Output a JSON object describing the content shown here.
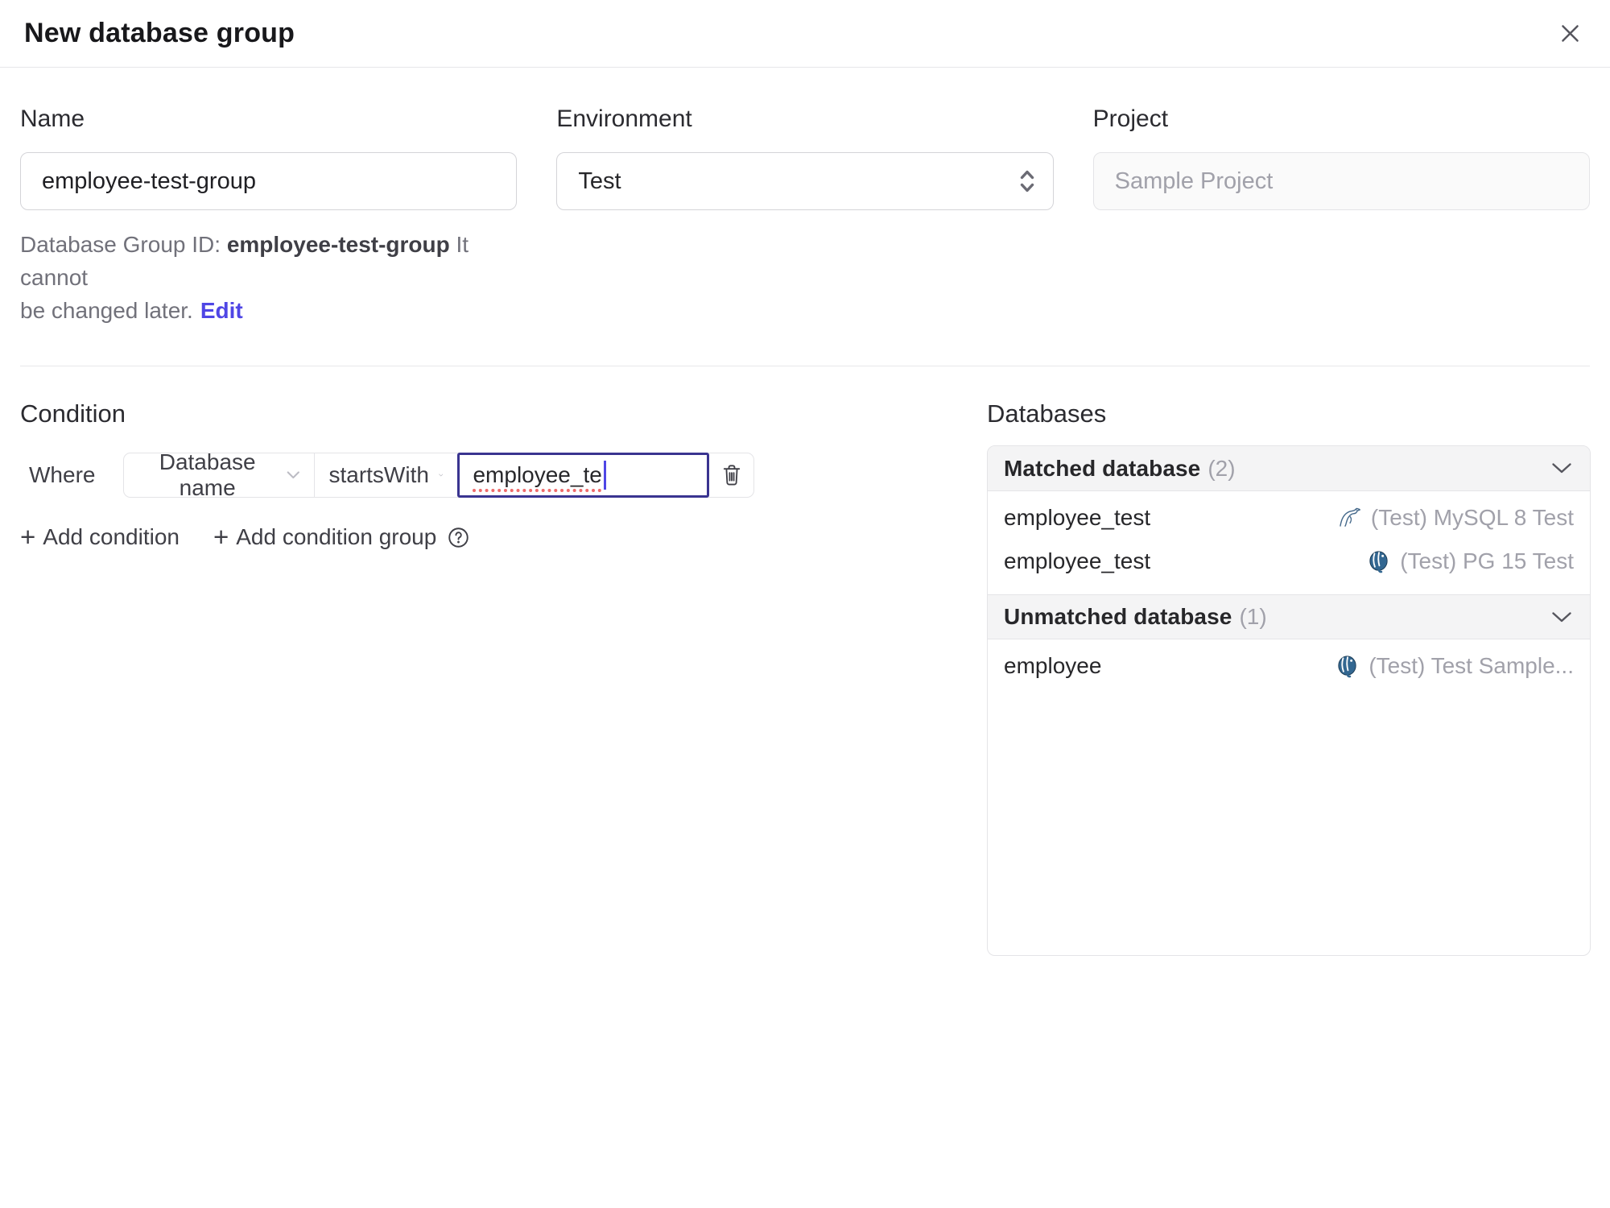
{
  "dialog": {
    "title": "New database group"
  },
  "form": {
    "name": {
      "label": "Name",
      "value": "employee-test-group"
    },
    "environment": {
      "label": "Environment",
      "value": "Test"
    },
    "project": {
      "label": "Project",
      "value": "Sample Project"
    },
    "group_id_note": {
      "prefix": "Database Group ID: ",
      "id": "employee-test-group",
      "suffix_line1": " It cannot",
      "suffix_line2": "be changed later.",
      "edit_link": "Edit"
    }
  },
  "condition": {
    "heading": "Condition",
    "where_label": "Where",
    "field": "Database name",
    "operator": "startsWith",
    "value": "employee_te",
    "plus": "+",
    "add_condition_label": "Add condition",
    "add_condition_group_label": "Add condition group"
  },
  "databases": {
    "heading": "Databases",
    "sections": [
      {
        "title": "Matched database",
        "count": "(2)",
        "rows": [
          {
            "name": "employee_test",
            "engine": "mysql",
            "instance": "(Test) MySQL 8 Test"
          },
          {
            "name": "employee_test",
            "engine": "postgres",
            "instance": "(Test) PG 15 Test"
          }
        ]
      },
      {
        "title": "Unmatched database",
        "count": "(1)",
        "rows": [
          {
            "name": "employee",
            "engine": "postgres",
            "instance": "(Test) Test Sample..."
          }
        ]
      }
    ]
  },
  "icons": {
    "close": "x-icon",
    "environment_selector": "chevron-up-down-icon",
    "condition_dropdowns": "chevron-down-icon",
    "delete_condition": "trash-icon",
    "help": "question-circle-icon",
    "section_collapse": "chevron-down-icon",
    "mysql_engine": "mysql-dolphin-icon",
    "postgres_engine": "postgres-elephant-icon"
  },
  "colors": {
    "accent_link": "#4f46e5",
    "focused_input_border": "#3a3490",
    "spellcheck_underline": "#ef6b6b",
    "mysql_icon_blue": "#44688a",
    "postgres_icon_blue": "#336791",
    "panel_header_bg": "#f4f4f5",
    "border": "#e4e4e7",
    "text_primary": "#27272a",
    "text_secondary": "#71717a",
    "text_muted": "#a1a1aa"
  }
}
